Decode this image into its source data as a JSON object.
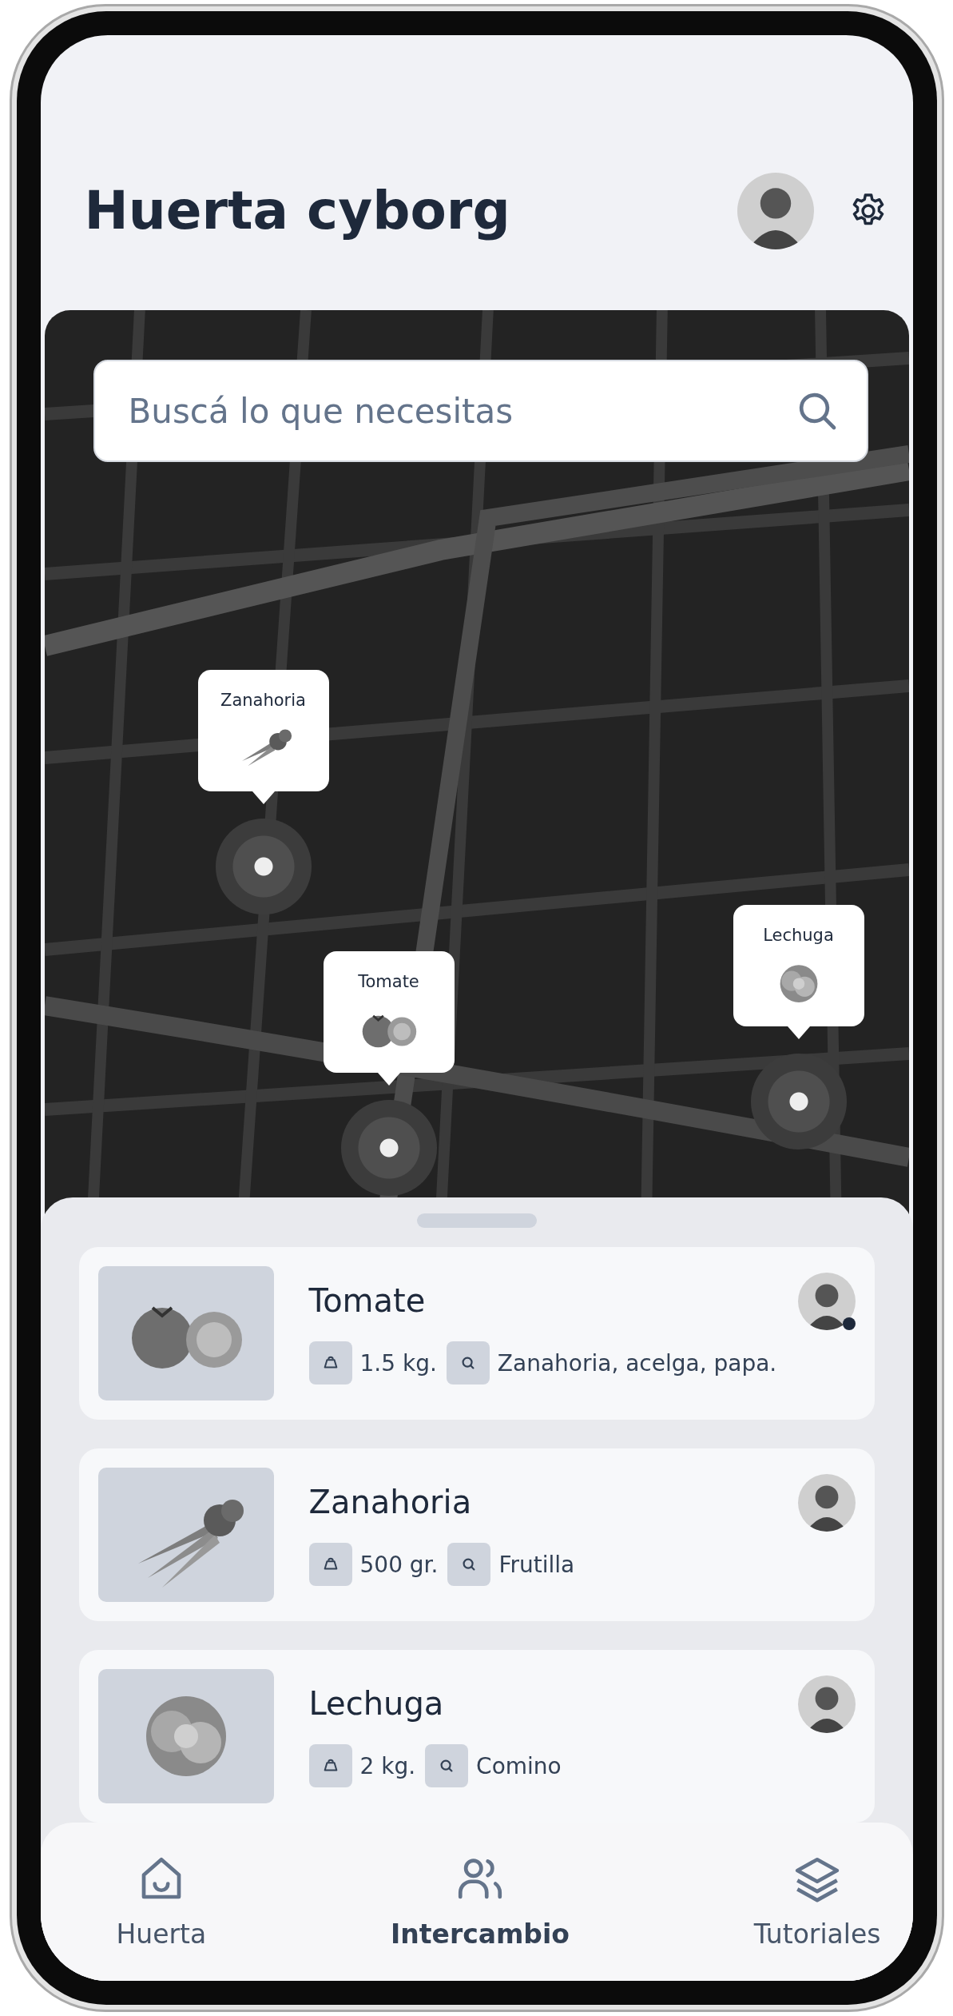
{
  "app": {
    "title": "Huerta cyborg"
  },
  "search": {
    "placeholder": "Buscá lo que necesitas"
  },
  "map": {
    "kind": "picture",
    "markers": [
      {
        "label": "Zanahoria"
      },
      {
        "label": "Tomate"
      },
      {
        "label": "Lechuga"
      }
    ]
  },
  "items": [
    {
      "name": "Tomate",
      "quantity": "1.5 kg.",
      "wants": "Zanahoria, acelga, papa.",
      "online": true
    },
    {
      "name": "Zanahoria",
      "quantity": "500 gr.",
      "wants": "Frutilla",
      "online": false
    },
    {
      "name": "Lechuga",
      "quantity": "2 kg.",
      "wants": "Comino",
      "online": false
    }
  ],
  "nav": [
    {
      "label": "Huerta",
      "kind": "home",
      "selected": false
    },
    {
      "label": "Intercambio",
      "kind": "people",
      "selected": true
    },
    {
      "label": "Tutoriales",
      "kind": "layers",
      "selected": false
    }
  ]
}
